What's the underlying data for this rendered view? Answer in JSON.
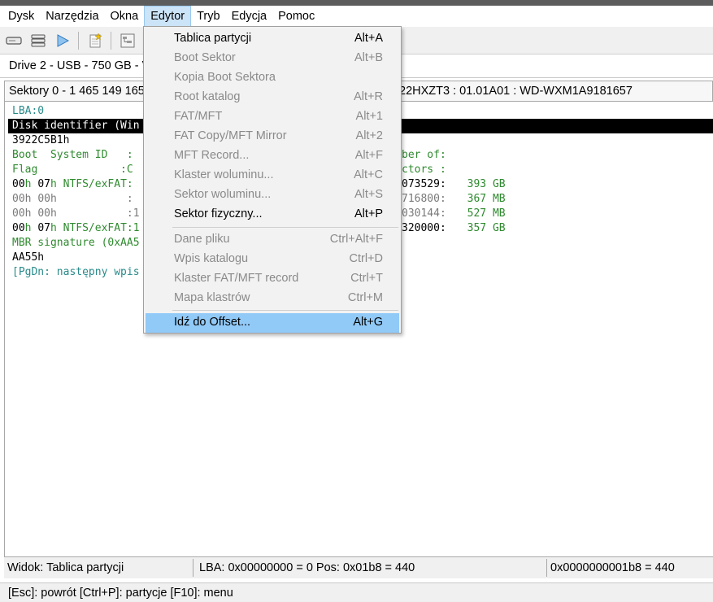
{
  "menubar": {
    "items": [
      "Dysk",
      "Narzędzia",
      "Okna",
      "Edytor",
      "Tryb",
      "Edycja",
      "Pomoc"
    ],
    "active_index": 3
  },
  "toolbar": {
    "icons": [
      "drive-icon",
      "stack-icon",
      "play-icon",
      "new-page-icon",
      "tree-view-icon"
    ]
  },
  "drive": {
    "label": "Drive 2 - USB - 750 GB - V"
  },
  "sectors_bar": {
    "left": "Sektory 0 - 1 465 149 165",
    "right": "22HXZT3 : 01.01A01 : WD-WXM1A9181657"
  },
  "content": {
    "lba": "LBA:0",
    "disk_identifier": "Disk identifier (Win",
    "disk_id_value": "3922C5B1h",
    "header1_left": "Boot  System ID   :",
    "header1_right": "ber of:",
    "header2_left": "Flag             :C",
    "header2_right": "ctors :",
    "rows": [
      {
        "flag": "00",
        "id": "07",
        "fs": " NTFS/exFAT:",
        "right_num": "073529:",
        "size": "  393 GB",
        "style": "black"
      },
      {
        "flag": "00",
        "id": "00",
        "fs": "           :",
        "right_num": "716800:",
        "size": "  367 MB",
        "style": "gray"
      },
      {
        "flag": "00",
        "id": "00",
        "fs": "           :1",
        "right_num": "030144:",
        "size": "  527 MB",
        "style": "gray"
      },
      {
        "flag": "00",
        "id": "07",
        "fs": " NTFS/exFAT:1",
        "right_num": "320000:",
        "size": "  357 GB",
        "style": "black"
      }
    ],
    "mbr_signature": "MBR signature (0xAA5",
    "mbr_value": "AA55h",
    "pgdn_hint": "[PgDn: następny wpis"
  },
  "edytor_menu": {
    "items": [
      {
        "label": "Tablica partycji",
        "shortcut": "Alt+A",
        "state": "enabled"
      },
      {
        "label": "Boot Sektor",
        "shortcut": "Alt+B",
        "state": "disabled"
      },
      {
        "label": "Kopia Boot Sektora",
        "shortcut": "",
        "state": "disabled"
      },
      {
        "label": "Root katalog",
        "shortcut": "Alt+R",
        "state": "disabled"
      },
      {
        "label": "FAT/MFT",
        "shortcut": "Alt+1",
        "state": "disabled"
      },
      {
        "label": "FAT Copy/MFT Mirror",
        "shortcut": "Alt+2",
        "state": "disabled"
      },
      {
        "label": "MFT Record...",
        "shortcut": "Alt+F",
        "state": "disabled"
      },
      {
        "label": "Klaster woluminu...",
        "shortcut": "Alt+C",
        "state": "disabled"
      },
      {
        "label": "Sektor woluminu...",
        "shortcut": "Alt+S",
        "state": "disabled"
      },
      {
        "label": "Sektor fizyczny...",
        "shortcut": "Alt+P",
        "state": "enabled"
      },
      {
        "label": "Dane pliku",
        "shortcut": "Ctrl+Alt+F",
        "state": "disabled"
      },
      {
        "label": "Wpis katalogu",
        "shortcut": "Ctrl+D",
        "state": "disabled"
      },
      {
        "label": "Klaster FAT/MFT record",
        "shortcut": "Ctrl+T",
        "state": "disabled"
      },
      {
        "label": "Mapa klastrów",
        "shortcut": "Ctrl+M",
        "state": "disabled"
      },
      {
        "label": "Idź do Offset...",
        "shortcut": "Alt+G",
        "state": "selected"
      }
    ]
  },
  "statusbar": {
    "view": "Widok:  Tablica partycji",
    "lba": "LBA: 0x00000000 = 0  Pos: 0x01b8 = 440",
    "offset": "0x0000000001b8 = 440"
  },
  "hint": "[Esc]: powrót  [Ctrl+P]: partycje  [F10]: menu",
  "colors": {
    "menu_highlight": "#91c9f7",
    "teal_text": "#2a8a8a",
    "green_text": "#2f8a2f",
    "gray_text": "#7a7a7a",
    "selection_bar": "#000000"
  }
}
